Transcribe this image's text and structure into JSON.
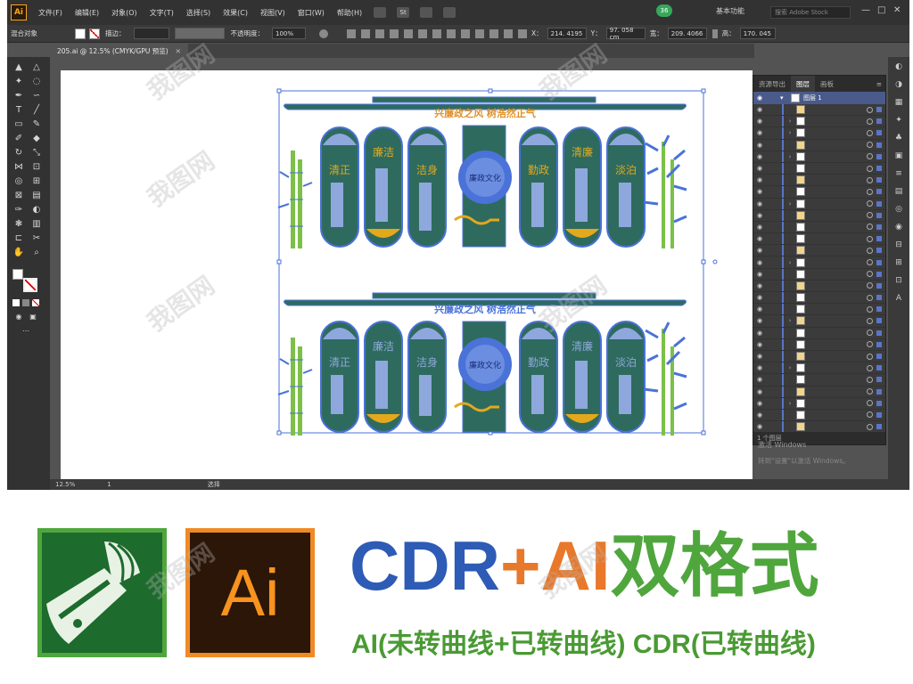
{
  "app": {
    "logo": "Ai",
    "menu": [
      "文件(F)",
      "编辑(E)",
      "对象(O)",
      "文字(T)",
      "选择(S)",
      "效果(C)",
      "视图(V)",
      "窗口(W)",
      "帮助(H)"
    ],
    "badge": "36",
    "workspace": "基本功能",
    "search_placeholder": "搜索 Adobe Stock",
    "win_controls": [
      "—",
      "□",
      "✕"
    ],
    "bridge_label": "St"
  },
  "control_bar": {
    "object_type": "混合对象",
    "stroke_label": "描边：",
    "opacity_label": "不透明度：",
    "opacity_value": "100%",
    "x_label": "X：",
    "x_value": "214. 4195",
    "y_label": "Y：",
    "y_value": "97. 058 cm",
    "w_label": "宽：",
    "w_value": "209. 4066",
    "h_label": "高：",
    "h_value": "170. 045"
  },
  "document_tab": {
    "title": "205.ai @ 12.5% (CMYK/GPU 预览)",
    "close": "✕"
  },
  "status_bar": {
    "zoom": "12.5%",
    "artboard": "1",
    "tool": "选择"
  },
  "layers_panel": {
    "tabs": [
      "资源导出",
      "图层",
      "画板"
    ],
    "active_tab": "图层",
    "top_layer_name": "图层 1",
    "row_count": 28,
    "footer": "1 个图层"
  },
  "windows_activation": {
    "line1": "激活 Windows",
    "line2": "转到\"设置\"以激活 Windows。"
  },
  "artwork": {
    "banner_top": "兴廉政之风  树浩然正气",
    "banner_bottom": "兴廉政之风  树浩然正气",
    "panels": [
      "清正",
      "廉洁",
      "洁身",
      "勤政",
      "清廉",
      "淡泊"
    ],
    "center_label": "廉政文化",
    "colors": {
      "panel_green": "#2e6b5e",
      "outline_blue": "#4a72d8",
      "gold": "#e3a81b",
      "banner_orange": "#e0902a",
      "bamboo_green": "#7cc049"
    }
  },
  "promo": {
    "title_part1": "CDR",
    "title_part2": "+AI",
    "title_part3": "双格式",
    "subtitle": "AI(未转曲线+已转曲线) CDR(已转曲线)",
    "ai_logo_text": "Ai",
    "colors": {
      "blue": "#2d5bb5",
      "orange": "#e8782a",
      "green": "#4fa63d"
    }
  },
  "watermark_text": "我图网"
}
